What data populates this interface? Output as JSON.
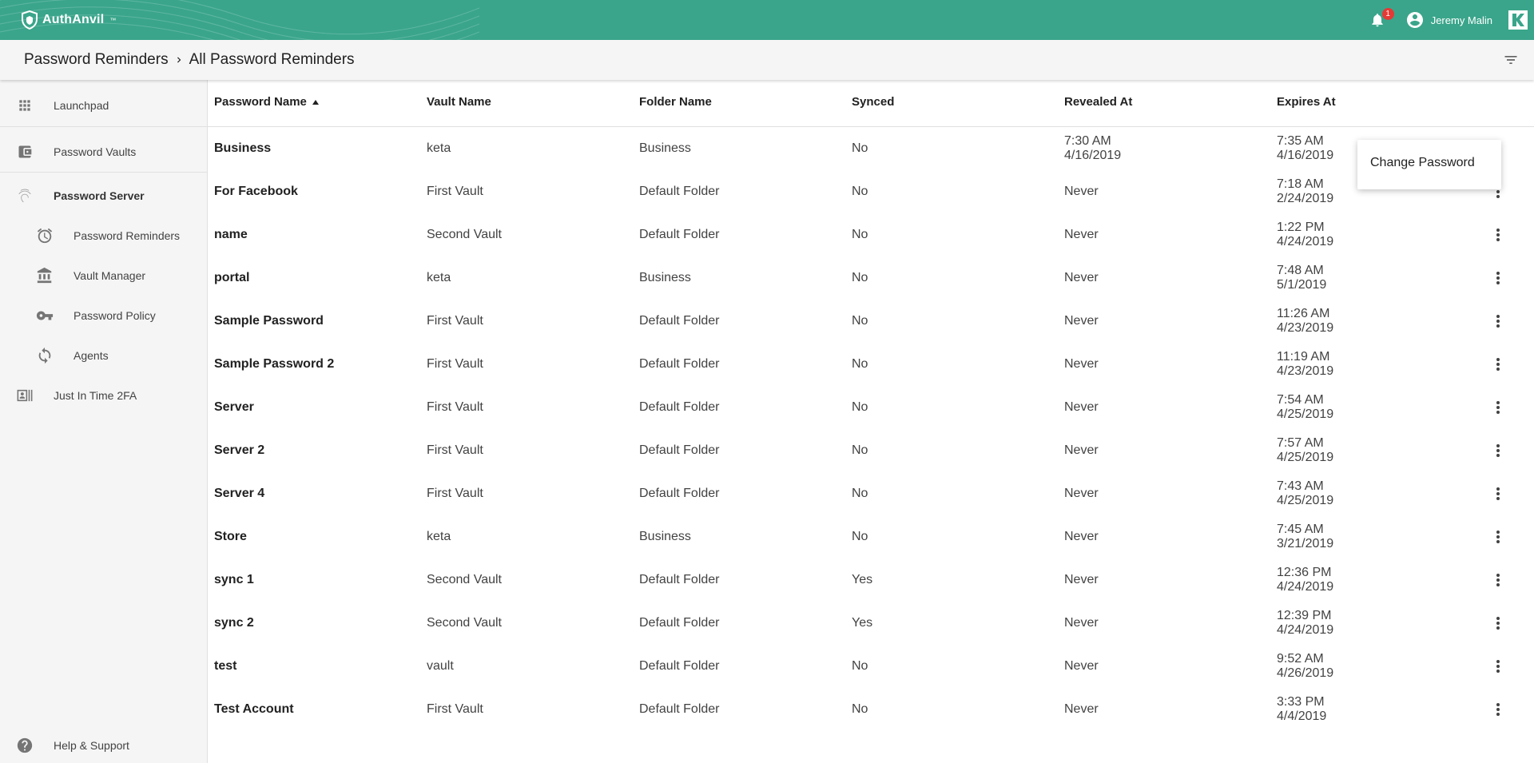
{
  "app": {
    "brand": "AuthAnvil",
    "brand_tm": "™",
    "notification_count": "1",
    "user_name": "Jeremy Malin",
    "colors": {
      "topbar": "#3aa58b",
      "badge": "#e53935",
      "sidebar": "#f5f5f5"
    }
  },
  "breadcrumb": {
    "parent": "Password Reminders",
    "current": "All Password Reminders"
  },
  "sidebar": {
    "items": [
      {
        "label": "Launchpad",
        "icon": "apps-grid-icon"
      },
      {
        "label": "Password Vaults",
        "icon": "wallet-icon"
      },
      {
        "label": "Password Server",
        "icon": "fingerprint-icon"
      },
      {
        "label": "Password Reminders",
        "icon": "alarm-clock-icon"
      },
      {
        "label": "Vault Manager",
        "icon": "bank-icon"
      },
      {
        "label": "Password Policy",
        "icon": "key-icon"
      },
      {
        "label": "Agents",
        "icon": "sync-icon"
      },
      {
        "label": "Just In Time 2FA",
        "icon": "id-card-icon"
      }
    ],
    "footer": {
      "label": "Help & Support",
      "icon": "help-circle-icon"
    }
  },
  "table": {
    "columns": [
      "Password Name",
      "Vault Name",
      "Folder Name",
      "Synced",
      "Revealed At",
      "Expires At"
    ],
    "sorted_column": "Password Name",
    "sort_direction": "ascending",
    "rows": [
      {
        "name": "Business",
        "vault": "keta",
        "folder": "Business",
        "synced": "No",
        "revealed_time": "7:30 AM",
        "revealed_date": "4/16/2019",
        "expires_time": "7:35 AM",
        "expires_date": "4/16/2019"
      },
      {
        "name": "For Facebook",
        "vault": "First Vault",
        "folder": "Default Folder",
        "synced": "No",
        "revealed": "Never",
        "expires_time": "7:18 AM",
        "expires_date": "2/24/2019"
      },
      {
        "name": "name",
        "vault": "Second Vault",
        "folder": "Default Folder",
        "synced": "No",
        "revealed": "Never",
        "expires_time": "1:22 PM",
        "expires_date": "4/24/2019"
      },
      {
        "name": "portal",
        "vault": "keta",
        "folder": "Business",
        "synced": "No",
        "revealed": "Never",
        "expires_time": "7:48 AM",
        "expires_date": "5/1/2019"
      },
      {
        "name": "Sample Password",
        "vault": "First Vault",
        "folder": "Default Folder",
        "synced": "No",
        "revealed": "Never",
        "expires_time": "11:26 AM",
        "expires_date": "4/23/2019"
      },
      {
        "name": "Sample Password 2",
        "vault": "First Vault",
        "folder": "Default Folder",
        "synced": "No",
        "revealed": "Never",
        "expires_time": "11:19 AM",
        "expires_date": "4/23/2019"
      },
      {
        "name": "Server",
        "vault": "First Vault",
        "folder": "Default Folder",
        "synced": "No",
        "revealed": "Never",
        "expires_time": "7:54 AM",
        "expires_date": "4/25/2019"
      },
      {
        "name": "Server 2",
        "vault": "First Vault",
        "folder": "Default Folder",
        "synced": "No",
        "revealed": "Never",
        "expires_time": "7:57 AM",
        "expires_date": "4/25/2019"
      },
      {
        "name": "Server 4",
        "vault": "First Vault",
        "folder": "Default Folder",
        "synced": "No",
        "revealed": "Never",
        "expires_time": "7:43 AM",
        "expires_date": "4/25/2019"
      },
      {
        "name": "Store",
        "vault": "keta",
        "folder": "Business",
        "synced": "No",
        "revealed": "Never",
        "expires_time": "7:45 AM",
        "expires_date": "3/21/2019"
      },
      {
        "name": "sync 1",
        "vault": "Second Vault",
        "folder": "Default Folder",
        "synced": "Yes",
        "revealed": "Never",
        "expires_time": "12:36 PM",
        "expires_date": "4/24/2019"
      },
      {
        "name": "sync 2",
        "vault": "Second Vault",
        "folder": "Default Folder",
        "synced": "Yes",
        "revealed": "Never",
        "expires_time": "12:39 PM",
        "expires_date": "4/24/2019"
      },
      {
        "name": "test",
        "vault": "vault",
        "folder": "Default Folder",
        "synced": "No",
        "revealed": "Never",
        "expires_time": "9:52 AM",
        "expires_date": "4/26/2019"
      },
      {
        "name": "Test Account",
        "vault": "First Vault",
        "folder": "Default Folder",
        "synced": "No",
        "revealed": "Never",
        "expires_time": "3:33 PM",
        "expires_date": "4/4/2019"
      }
    ]
  },
  "row_menu": {
    "items": [
      "Change Password"
    ]
  }
}
